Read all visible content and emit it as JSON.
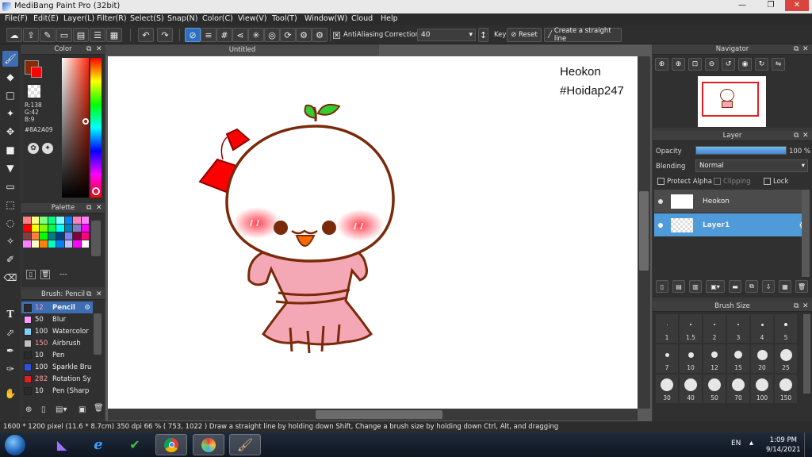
{
  "window": {
    "title": "MediBang Paint Pro (32bit)",
    "minimize": "—",
    "restore": "❐",
    "close": "✕"
  },
  "menu": [
    "File(F)",
    "Edit(E)",
    "Layer(L)",
    "Filter(R)",
    "Select(S)",
    "Snap(N)",
    "Color(C)",
    "View(V)",
    "Tool(T)",
    "Window(W)",
    "Cloud",
    "Help"
  ],
  "toolbar": {
    "antialiasing_label": "AntiAliasing",
    "correction_label": "Correction",
    "correction_value": "40",
    "key_label": "Key",
    "reset_label": "Reset",
    "straight_line_label": "Create a straight line"
  },
  "color_panel": {
    "title": "Color",
    "r": "R:138",
    "g": "G:42",
    "b": "B:9",
    "hex": "#8A2A09",
    "main_color": "#8A2A09",
    "sub_color": "#ff0000"
  },
  "palette": {
    "title": "Palette",
    "extra": "---",
    "swatches": [
      "#ff8080",
      "#ffff80",
      "#80ff80",
      "#00ff80",
      "#80ffff",
      "#0080ff",
      "#ff80c0",
      "#ff80ff",
      "#ff0000",
      "#ffff00",
      "#80ff00",
      "#00ff40",
      "#00ffff",
      "#0080c0",
      "#8080c0",
      "#ff00ff",
      "#804040",
      "#ff8040",
      "#00ff00",
      "#008080",
      "#004080",
      "#8080ff",
      "#800040",
      "#ff0080",
      "#ff80ff",
      "#ffffc0",
      "#ff8000",
      "#00ffc0",
      "#0080ff",
      "#c0c0ff",
      "#ff00ff",
      "#ffffff"
    ]
  },
  "brush_panel": {
    "title": "Brush: Pencil",
    "brushes": [
      {
        "size": "12",
        "name": "Pencil",
        "color": "#2a2a2a"
      },
      {
        "size": "50",
        "name": "Blur",
        "color": "#ff99ff"
      },
      {
        "size": "100",
        "name": "Watercolor",
        "color": "#80d0ff"
      },
      {
        "size": "150",
        "name": "Airbrush",
        "color": "#c0c0c0"
      },
      {
        "size": "10",
        "name": "Pen",
        "color": "#2a2a2a"
      },
      {
        "size": "100",
        "name": "Sparkle Bru",
        "color": "#3050e0"
      },
      {
        "size": "282",
        "name": "Rotation Sy",
        "color": "#e02020"
      },
      {
        "size": "10",
        "name": "Pen (Sharp",
        "color": "#2a2a2a"
      }
    ]
  },
  "document": {
    "tab": "Untitled",
    "caption_line1": "Heokon",
    "caption_line2": "#Hoidap247"
  },
  "navigator": {
    "title": "Navigator"
  },
  "layer_panel": {
    "title": "Layer",
    "opacity_label": "Opacity",
    "opacity_value": 100,
    "opacity_text": "100 %",
    "blending_label": "Blending",
    "blending_value": "Normal",
    "protect_alpha": "Protect Alpha",
    "clipping": "Clipping",
    "lock": "Lock",
    "layers": [
      {
        "name": "Heokon",
        "thumb": "Heokon\n#Hoidap247"
      },
      {
        "name": "Layer1",
        "thumb": ""
      }
    ]
  },
  "brush_size": {
    "title": "Brush Size",
    "sizes": [
      "1",
      "1.5",
      "2",
      "3",
      "4",
      "5",
      "7",
      "10",
      "12",
      "15",
      "20",
      "25",
      "30",
      "40",
      "50",
      "70",
      "100",
      "150"
    ]
  },
  "status": {
    "text": "1600 * 1200 pixel  (11.6 * 8.7cm)  350 dpi  66 %  ( 753, 1022 )  Draw a straight line by holding down Shift, Change a brush size by holding down Ctrl, Alt, and dragging"
  },
  "taskbar": {
    "lang": "EN",
    "time": "1:09 PM",
    "date": "9/14/2021"
  },
  "colors": {
    "accent": "#3d6eb2",
    "panel": "#303030",
    "selected_layer": "#4f9bd9"
  }
}
